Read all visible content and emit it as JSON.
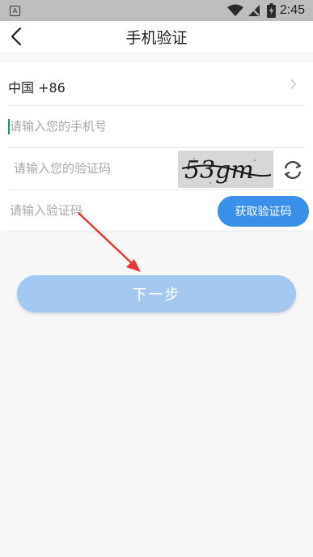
{
  "status_bar": {
    "time": "2:45",
    "app_indicator": "A"
  },
  "header": {
    "title": "手机验证",
    "back_icon": "chevron-left-icon"
  },
  "form": {
    "country": {
      "label": "中国 +86"
    },
    "phone": {
      "placeholder": "请输入您的手机号"
    },
    "captcha": {
      "placeholder": "请输入您的验证码",
      "image_text": "53gm"
    },
    "sms": {
      "placeholder": "请输入验证码",
      "button_label": "获取验证码"
    }
  },
  "next_button": {
    "label": "下一步"
  },
  "colors": {
    "primary": "#3a8fe8",
    "primary_disabled": "#a3c9f2",
    "annotation_arrow": "#e53935"
  }
}
